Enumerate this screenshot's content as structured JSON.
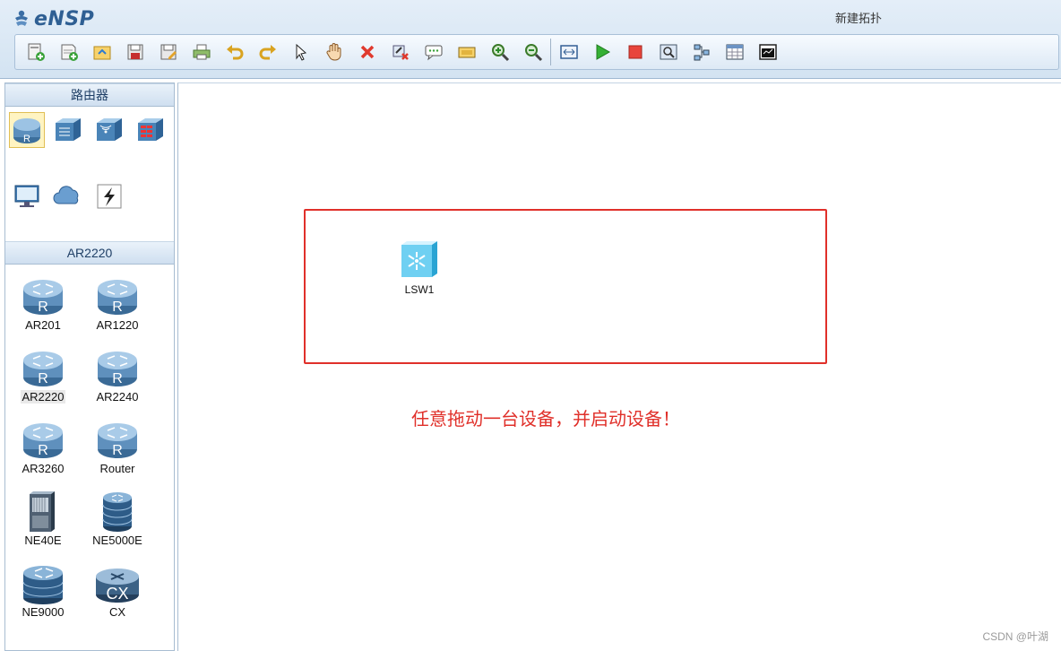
{
  "app": {
    "name": "eNSP",
    "window_title": "新建拓扑"
  },
  "toolbar": {
    "buttons": [
      "new-topology-icon",
      "new-exercise-icon",
      "open-icon",
      "save-icon",
      "save-as-icon",
      "print-icon",
      "undo-icon",
      "redo-icon",
      "select-icon",
      "pan-hand-icon",
      "delete-icon",
      "delete-links-icon",
      "text-note-icon",
      "palette-icon",
      "zoom-in-icon",
      "zoom-out-icon",
      "fit-icon",
      "start-device-icon",
      "stop-device-icon",
      "capture-icon",
      "topology-icon",
      "grid-icon",
      "console-icon"
    ]
  },
  "left_panel": {
    "category_title": "路由器",
    "categories": [
      {
        "name": "router-category-icon",
        "selected": true
      },
      {
        "name": "switch-category-icon",
        "selected": false
      },
      {
        "name": "wireless-category-icon",
        "selected": false
      },
      {
        "name": "firewall-category-icon",
        "selected": false
      },
      {
        "name": "terminal-category-icon",
        "selected": false
      },
      {
        "name": "cloud-category-icon",
        "selected": false
      },
      {
        "name": "connection-category-icon",
        "selected": false
      }
    ],
    "device_section_title": "AR2220",
    "devices": [
      {
        "label": "AR201",
        "icon": "router-icon"
      },
      {
        "label": "AR1220",
        "icon": "router-icon"
      },
      {
        "label": "AR2220",
        "icon": "router-icon",
        "highlighted": true
      },
      {
        "label": "AR2240",
        "icon": "router-icon"
      },
      {
        "label": "AR3260",
        "icon": "router-icon"
      },
      {
        "label": "Router",
        "icon": "router-icon"
      },
      {
        "label": "NE40E",
        "icon": "chassis-icon"
      },
      {
        "label": "NE5000E",
        "icon": "core-router-icon"
      },
      {
        "label": "NE9000",
        "icon": "core-router-icon"
      },
      {
        "label": "CX",
        "icon": "cx-router-icon"
      }
    ]
  },
  "canvas": {
    "node": {
      "label": "LSW1",
      "icon": "switch-icon"
    },
    "annotation": "任意拖动一台设备，并启动设备！"
  },
  "watermark": "CSDN @叶湖"
}
